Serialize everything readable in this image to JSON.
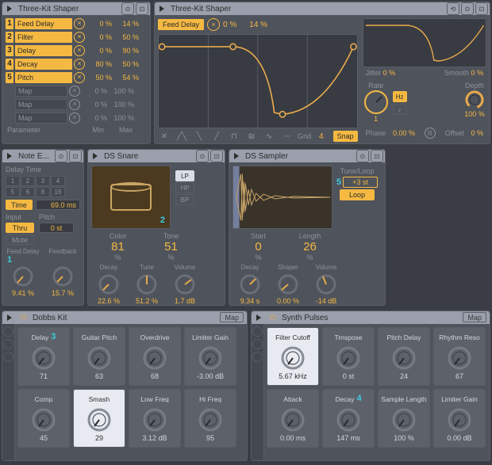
{
  "shaper_left": {
    "title": "Three-Kit Shaper",
    "rows": [
      {
        "idx": "1",
        "name": "Feed Delay",
        "min": "0 %",
        "max": "14 %",
        "active": true
      },
      {
        "idx": "2",
        "name": "Filter",
        "min": "0 %",
        "max": "50 %",
        "active": true
      },
      {
        "idx": "3",
        "name": "Delay",
        "min": "0 %",
        "max": "90 %",
        "active": true
      },
      {
        "idx": "4",
        "name": "Decay",
        "min": "80 %",
        "max": "50 %",
        "active": true
      },
      {
        "idx": "5",
        "name": "Pitch",
        "min": "50 %",
        "max": "54 %",
        "active": true
      },
      {
        "idx": "",
        "name": "Map",
        "min": "0 %",
        "max": "100 %",
        "active": false
      },
      {
        "idx": "",
        "name": "Map",
        "min": "0 %",
        "max": "100 %",
        "active": false
      },
      {
        "idx": "",
        "name": "Map",
        "min": "0 %",
        "max": "100 %",
        "active": false
      }
    ],
    "foot": {
      "c1": "Parameter",
      "c2": "Min",
      "c3": "Max"
    }
  },
  "shaper_right": {
    "title": "Three-Kit Shaper",
    "tag": "Feed Delay",
    "tag_min": "0 %",
    "tag_max": "14 %",
    "gridlbl": "Grid",
    "grid": "4",
    "snap": "Snap",
    "jitter_label": "Jitter",
    "jitter": "0 %",
    "smooth_label": "Smooth",
    "smooth": "0 %",
    "rate_label": "Rate",
    "rate": "1",
    "hz": "Hz",
    "note_icon": "♪",
    "depth_label": "Depth",
    "depth": "100 %",
    "phase_label": "Phase",
    "phase": "0.00 %",
    "r": "R",
    "offset_label": "Offset",
    "offset": "0 %"
  },
  "note_echo": {
    "title": "Note E...",
    "delay_label": "Delay Time",
    "grid": [
      [
        "1",
        "2",
        "3",
        "4"
      ],
      [
        "5",
        "6",
        "8",
        "16"
      ]
    ],
    "time_btn": "Time",
    "time_val": "69.0 ms",
    "input_label": "Input",
    "pitch_label": "Pitch",
    "thru": "Thru",
    "mute": "Mute",
    "pitch_val": "0 st",
    "k1_label": "Feed Delay",
    "k1_val": "9.41 %",
    "k1_badge": "1",
    "k2_label": "Feedback",
    "k2_val": "15.7 %"
  },
  "ds_snare": {
    "title": "DS Snare",
    "color_label": "Color",
    "color": "81",
    "tone_label": "Tone",
    "tone": "51",
    "pct": "%",
    "badge": "2",
    "lp": "LP",
    "hp": "HP",
    "bp": "BP",
    "decay_label": "Decay",
    "decay": "22.6 %",
    "tune_label": "Tune",
    "tune": "51.2 %",
    "vol_label": "Volume",
    "vol": "1.7 dB"
  },
  "ds_sampler": {
    "title": "DS Sampler",
    "start_label": "Start",
    "start": "0",
    "length_label": "Length",
    "length": "26",
    "pct": "%",
    "badge": "5",
    "tune_label": "Tune/Loop",
    "tune_val": "+3 st",
    "loop": "Loop",
    "decay_label": "Decay",
    "decay": "9.34 s",
    "shaper_label": "Shaper",
    "shaper": "0.00 %",
    "vol_label": "Volume",
    "vol": "-14 dB"
  },
  "rack_dobbs": {
    "title": "Dobbs Kit",
    "map": "Map",
    "macros": [
      {
        "l": "Delay",
        "v": "71",
        "badge": "3"
      },
      {
        "l": "Guitar Pitch",
        "v": "63"
      },
      {
        "l": "Overdrive",
        "v": "68"
      },
      {
        "l": "Limiter Gain",
        "v": "-3.00 dB"
      },
      {
        "l": "Comp",
        "v": "45"
      },
      {
        "l": "Smash",
        "v": "29",
        "sel": true
      },
      {
        "l": "Low Freq",
        "v": "3.12 dB"
      },
      {
        "l": "Hi Freq",
        "v": "95"
      }
    ]
  },
  "rack_synth": {
    "title": "Synth Pulses",
    "map": "Map",
    "macros": [
      {
        "l": "Filter Cutoff",
        "v": "5.67 kHz",
        "sel": true
      },
      {
        "l": "Trnspose",
        "v": "0 st"
      },
      {
        "l": "Pitch Delay",
        "v": "24"
      },
      {
        "l": "Rhythm Reso",
        "v": "67"
      },
      {
        "l": "Attack",
        "v": "0.00 ms"
      },
      {
        "l": "Decay",
        "v": "147 ms",
        "badge": "4"
      },
      {
        "l": "Sample Length",
        "v": "100 %"
      },
      {
        "l": "Limiter Gain",
        "v": "0.00 dB"
      }
    ]
  }
}
